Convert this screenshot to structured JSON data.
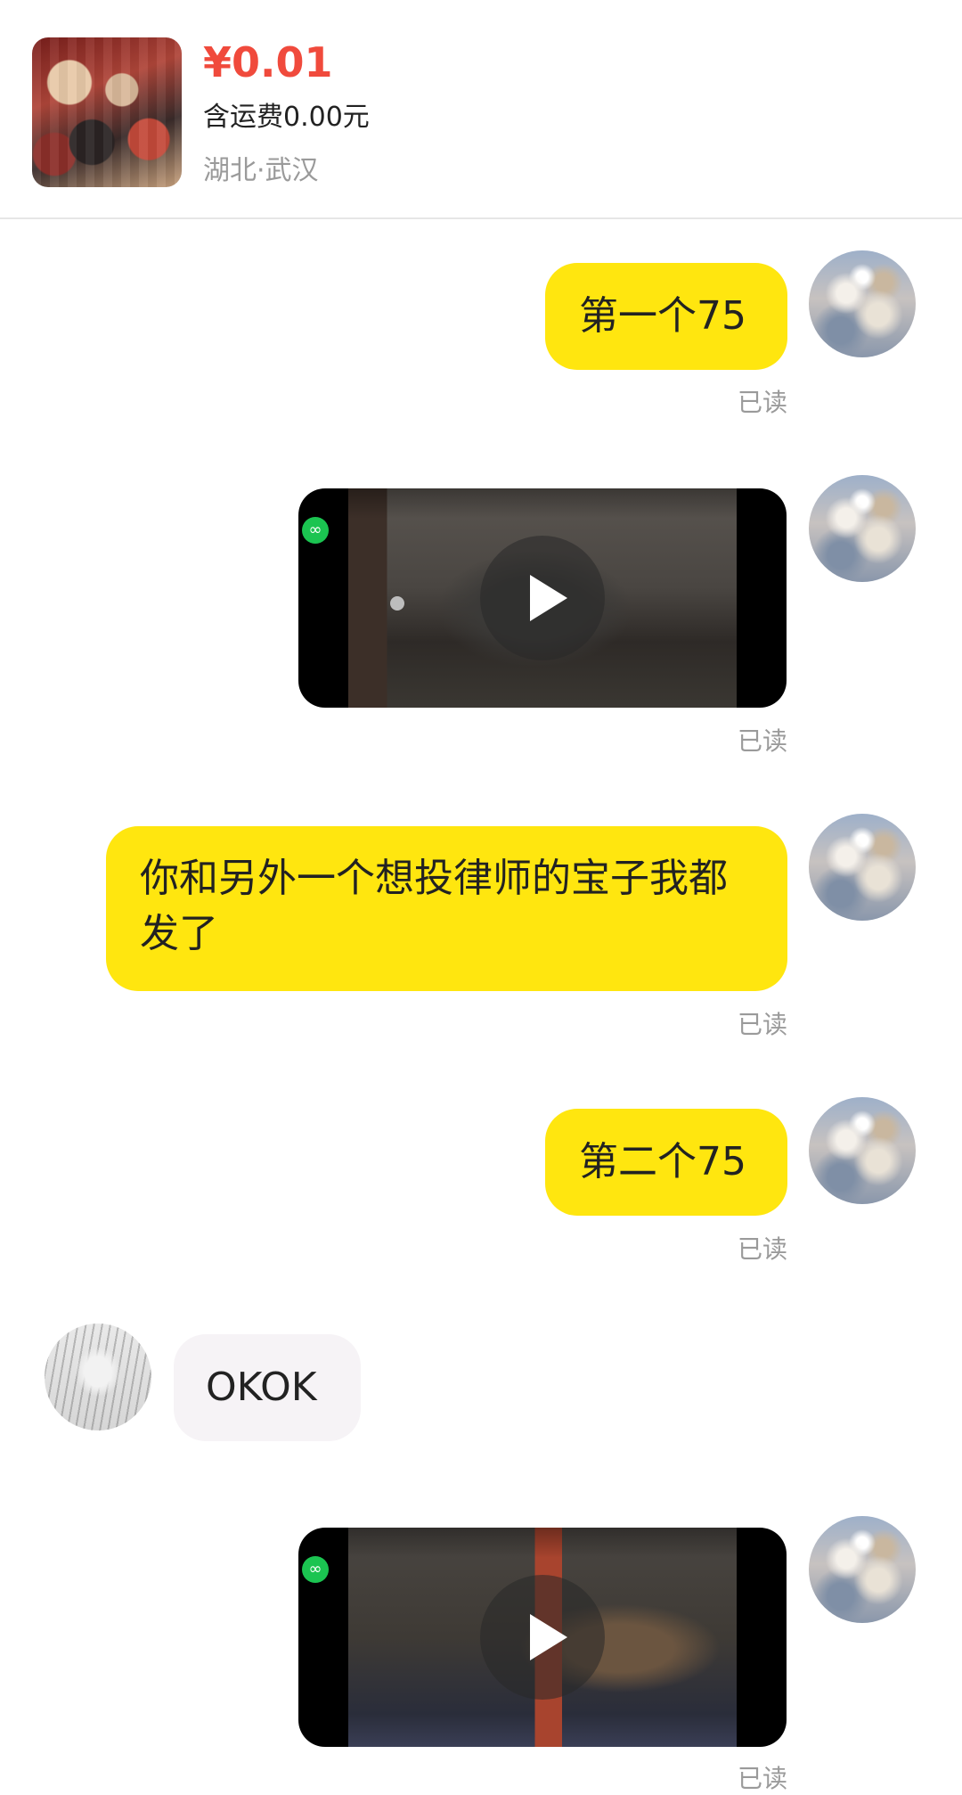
{
  "product": {
    "price": "¥0.01",
    "shipping": "含运费0.00元",
    "location": "湖北·武汉"
  },
  "messages": [
    {
      "type": "text",
      "sender": "self",
      "text": "第一个75",
      "status": "已读"
    },
    {
      "type": "video",
      "sender": "self",
      "status": "已读"
    },
    {
      "type": "text",
      "sender": "self",
      "text": "你和另外一个想投律师的宝子我都发了",
      "status": "已读"
    },
    {
      "type": "text",
      "sender": "self",
      "text": "第二个75",
      "status": "已读"
    },
    {
      "type": "text",
      "sender": "other",
      "text": "OKOK"
    },
    {
      "type": "video",
      "sender": "self",
      "status": "已读"
    }
  ],
  "icons": {
    "link": "link-icon",
    "play": "play-icon"
  },
  "colors": {
    "self_bubble": "#ffe60f",
    "other_bubble": "#f6f3f6",
    "price": "#f04a3c",
    "read_receipt": "#9a9a9a",
    "link_badge": "#1bc451"
  }
}
